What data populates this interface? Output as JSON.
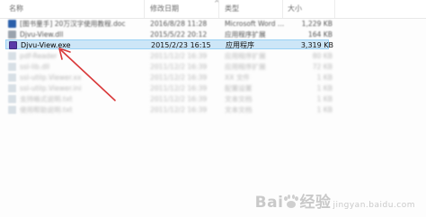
{
  "columns": {
    "name": "名称",
    "date": "修改日期",
    "type": "类型",
    "size": "大小",
    "sort_indicator": "^"
  },
  "files": [
    {
      "name": "[图书童手] 20万汉字使用教程.doc",
      "date": "2016/8/28 11:28",
      "type": "Microsoft Word ...",
      "size": "1,229 KB",
      "icon": "word-doc-icon",
      "icon_color": "#2b5faa"
    },
    {
      "name": "Djvu-View.dll",
      "date": "2015/5/22 20:12",
      "type": "应用程序扩展",
      "size": "164 KB",
      "icon": "dll-file-icon",
      "icon_color": "#9aa3ad"
    },
    {
      "name": "Djvu-View.exe",
      "date": "2015/2/23 16:15",
      "type": "应用程序",
      "size": "3,319 KB",
      "icon": "djvu-app-icon",
      "icon_color": "#5b3aa8"
    },
    {
      "name": "pdf-Reader",
      "date": "2011/12/2 16:39",
      "type": "应用程序扩展",
      "size": "80 KB",
      "icon": "file-icon",
      "icon_color": "#b9c7d3"
    },
    {
      "name": "ssl-lib.dll",
      "date": "2011/12/2 16:39",
      "type": "应用程序扩展",
      "size": "72 KB",
      "icon": "file-icon",
      "icon_color": "#b9c7d3"
    },
    {
      "name": "ssl-utilp.Viewer.xx",
      "date": "2011/12/2 16:39",
      "type": "XX 文件",
      "size": "1 KB",
      "icon": "file-icon",
      "icon_color": "#b9c7d3"
    },
    {
      "name": "ssl-utilp.Viewer.ini",
      "date": "2011/12/2 16:39",
      "type": "配置设置",
      "size": "1 KB",
      "icon": "settings-file-icon",
      "icon_color": "#b9c7d3"
    },
    {
      "name": "支持格式说明.txt",
      "date": "2011/12/2 16:39",
      "type": "文本文档",
      "size": "1 KB",
      "icon": "text-file-icon",
      "icon_color": "#b9c7d3"
    },
    {
      "name": "使用帮助说明.txt",
      "date": "2011/12/2 16:39",
      "type": "文本文档",
      "size": "1 KB",
      "icon": "text-file-icon",
      "icon_color": "#b9c7d3"
    }
  ],
  "selected_index": 2,
  "annotation": {
    "color": "#d9393a"
  },
  "watermark": {
    "text_left": "Bai",
    "text_right": "经验",
    "sub": "jingyan.baidu.com"
  }
}
